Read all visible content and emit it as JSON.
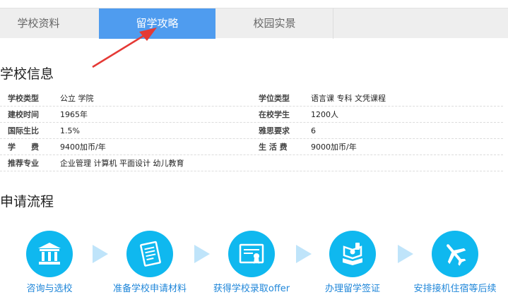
{
  "tabs": [
    {
      "label": "学校资料",
      "active": false
    },
    {
      "label": "留学攻略",
      "active": true
    },
    {
      "label": "校园实景",
      "active": false
    }
  ],
  "school_info": {
    "title": "学校信息",
    "rows": [
      {
        "label1": "学校类型",
        "value1": "公立 学院",
        "label2": "学位类型",
        "value2": "语言课 专科 文凭课程"
      },
      {
        "label1": "建校时间",
        "value1": "1965年",
        "label2": "在校学生",
        "value2": "1200人"
      },
      {
        "label1": "国际生比",
        "value1": "1.5%",
        "label2": "雅思要求",
        "value2": "6"
      },
      {
        "label1": "学　　费",
        "value1": "9400加币/年",
        "label2": "生 活 费",
        "value2": "9000加币/年"
      },
      {
        "label1": "推荐专业",
        "value1": "企业管理 计算机 平面设计 幼儿教育"
      }
    ]
  },
  "process": {
    "title": "申请流程",
    "steps": [
      {
        "label": "咨询与选校",
        "icon": "bank-icon"
      },
      {
        "label": "准备学校申请材料",
        "icon": "document-icon"
      },
      {
        "label": "获得学校录取offer",
        "icon": "certificate-icon"
      },
      {
        "label": "办理留学签证",
        "icon": "passport-icon"
      },
      {
        "label": "安排接机住宿等后续",
        "icon": "airplane-icon"
      }
    ]
  },
  "colors": {
    "tab_active": "#4f9cef",
    "step_circle": "#0fb8ef",
    "step_label": "#1f86d9",
    "arrow": "#e53935"
  }
}
